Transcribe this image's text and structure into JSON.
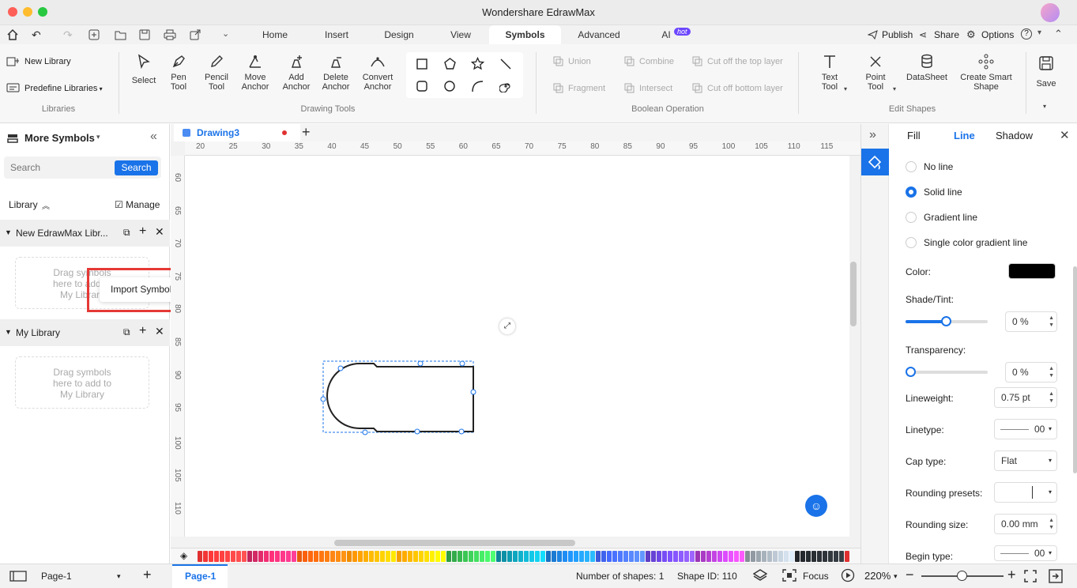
{
  "app": {
    "title": "Wondershare EdrawMax"
  },
  "menu": {
    "tabs": [
      "Home",
      "Insert",
      "Design",
      "View",
      "Symbols",
      "Advanced",
      "AI"
    ],
    "active": "Symbols",
    "ai_badge": "hot",
    "right": [
      "Publish",
      "Share",
      "Options"
    ]
  },
  "ribbon": {
    "libraries": {
      "new_library": "New Library",
      "predefine": "Predefine Libraries",
      "group": "Libraries"
    },
    "drawing": {
      "select": "Select",
      "pen1": "Pen",
      "pen2": "Tool",
      "pencil1": "Pencil",
      "pencil2": "Tool",
      "move1": "Move",
      "move2": "Anchor",
      "add1": "Add",
      "add2": "Anchor",
      "delete1": "Delete",
      "delete2": "Anchor",
      "convert1": "Convert",
      "convert2": "Anchor",
      "group": "Drawing Tools"
    },
    "boolean": {
      "union": "Union",
      "combine": "Combine",
      "cut_top": "Cut off the top layer",
      "fragment": "Fragment",
      "intersect": "Intersect",
      "cut_bottom": "Cut off bottom layer",
      "group": "Boolean Operation"
    },
    "edit": {
      "text1": "Text",
      "text2": "Tool",
      "point1": "Point",
      "point2": "Tool",
      "datasheet": "DataSheet",
      "smart1": "Create Smart",
      "smart2": "Shape",
      "save": "Save",
      "group": "Edit Shapes"
    }
  },
  "left": {
    "title": "More Symbols",
    "search_placeholder": "Search",
    "search_btn": "Search",
    "library": "Library",
    "manage": "Manage",
    "lib1": {
      "name": "New EdrawMax Libr...",
      "drop1": "Drag symbols",
      "drop2": "here to add to",
      "drop3": "My Library"
    },
    "lib2": {
      "name": "My Library",
      "drop1": "Drag symbols",
      "drop2": "here to add to",
      "drop3": "My Library"
    },
    "popup": "Import Symbol..."
  },
  "canvas": {
    "tab": "Drawing3",
    "hticks": [
      "20",
      "25",
      "30",
      "35",
      "40",
      "45",
      "50",
      "55",
      "60",
      "65",
      "70",
      "75",
      "80",
      "85",
      "90",
      "95",
      "100",
      "105",
      "110",
      "115"
    ],
    "vticks": [
      "60",
      "65",
      "70",
      "75",
      "80",
      "85",
      "90",
      "95",
      "100",
      "105",
      "110"
    ]
  },
  "palette": [
    "#e03131",
    "#c2255c",
    "#e8590c",
    "#f08c00",
    "#f59f00",
    "#2f9e44",
    "#0c8599",
    "#1971c2",
    "#3b5bdb",
    "#5f3dc4",
    "#9c36b5",
    "#868e96",
    "#212529"
  ],
  "right": {
    "tabs": {
      "fill": "Fill",
      "line": "Line",
      "shadow": "Shadow"
    },
    "options": [
      "No line",
      "Solid line",
      "Gradient line",
      "Single color gradient line"
    ],
    "color": "Color:",
    "color_value": "#000000",
    "shade": "Shade/Tint:",
    "shade_value": "0 %",
    "transparency": "Transparency:",
    "transparency_value": "0 %",
    "lineweight": "Lineweight:",
    "lineweight_value": "0.75 pt",
    "linetype": "Linetype:",
    "linetype_value": "00",
    "captype": "Cap type:",
    "captype_value": "Flat",
    "rounding_presets": "Rounding presets:",
    "rounding_size": "Rounding size:",
    "rounding_size_value": "0.00 mm",
    "begin_type": "Begin type:",
    "begin_type_value": "00"
  },
  "status": {
    "page_select": "Page-1",
    "page_tab": "Page-1",
    "num_shapes": "Number of shapes: 1",
    "shape_id": "Shape ID: 110",
    "focus": "Focus",
    "zoom": "220%"
  }
}
